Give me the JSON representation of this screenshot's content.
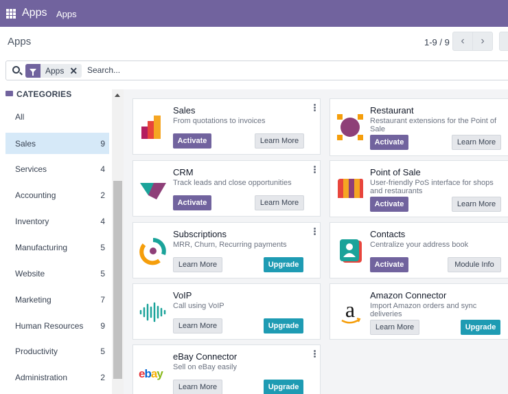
{
  "navbar": {
    "brand": "Apps",
    "menu_apps": "Apps"
  },
  "control_panel": {
    "title": "Apps",
    "pager": "1-9 / 9"
  },
  "search": {
    "facet_label": "Apps",
    "placeholder": "Search..."
  },
  "sidebar": {
    "header": "CATEGORIES",
    "items": [
      {
        "label": "All",
        "count": ""
      },
      {
        "label": "Sales",
        "count": "9"
      },
      {
        "label": "Services",
        "count": "4"
      },
      {
        "label": "Accounting",
        "count": "2"
      },
      {
        "label": "Inventory",
        "count": "4"
      },
      {
        "label": "Manufacturing",
        "count": "5"
      },
      {
        "label": "Website",
        "count": "5"
      },
      {
        "label": "Marketing",
        "count": "7"
      },
      {
        "label": "Human Resources",
        "count": "9"
      },
      {
        "label": "Productivity",
        "count": "5"
      },
      {
        "label": "Administration",
        "count": "2"
      }
    ]
  },
  "apps": [
    {
      "name": "Sales",
      "desc": "From quotations to invoices",
      "btn1": "Activate",
      "btn2": "Learn More"
    },
    {
      "name": "Restaurant",
      "desc": "Restaurant extensions for the Point of Sale",
      "btn1": "Activate",
      "btn2": "Learn More"
    },
    {
      "name": "CRM",
      "desc": "Track leads and close opportunities",
      "btn1": "Activate",
      "btn2": "Learn More"
    },
    {
      "name": "Point of Sale",
      "desc": "User-friendly PoS interface for shops and restaurants",
      "btn1": "Activate",
      "btn2": "Learn More"
    },
    {
      "name": "Subscriptions",
      "desc": "MRR, Churn, Recurring payments",
      "btn1": "Learn More",
      "btn2": "Upgrade"
    },
    {
      "name": "Contacts",
      "desc": "Centralize your address book",
      "btn1": "Activate",
      "btn2": "Module Info"
    },
    {
      "name": "VoIP",
      "desc": "Call using VoIP",
      "btn1": "Learn More",
      "btn2": "Upgrade"
    },
    {
      "name": "Amazon Connector",
      "desc": "Import Amazon orders and sync deliveries",
      "btn1": "Learn More",
      "btn2": "Upgrade"
    },
    {
      "name": "eBay Connector",
      "desc": "Sell on eBay easily",
      "btn1": "Learn More",
      "btn2": "Upgrade"
    }
  ],
  "logos": {
    "amazon": "a",
    "ebay": "ebay"
  },
  "colors": {
    "navbar": "#71639e",
    "primary": "#71639e",
    "upgrade": "#1e9bb3",
    "active_category": "#d6e9f8"
  }
}
